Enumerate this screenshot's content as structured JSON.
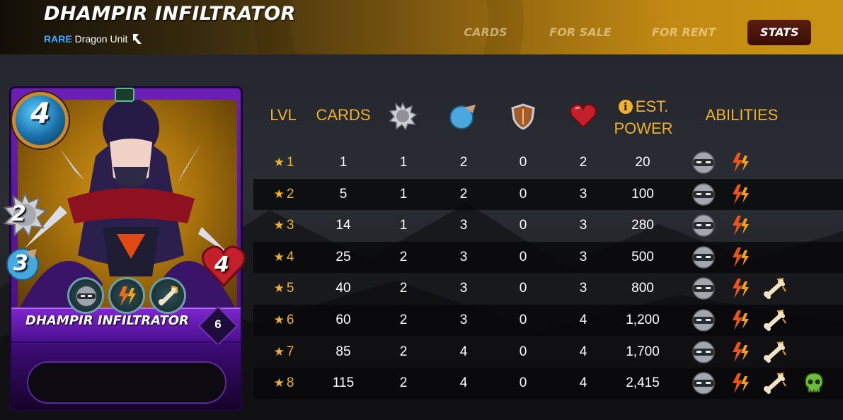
{
  "header": {
    "title": "DHAMPIR INFILTRATOR",
    "rarity": "RARE",
    "unit_type": "Dragon Unit",
    "tabs": [
      {
        "label": "CARDS",
        "active": false
      },
      {
        "label": "FOR SALE",
        "active": false
      },
      {
        "label": "FOR RENT",
        "active": false
      },
      {
        "label": "STATS",
        "active": true
      }
    ]
  },
  "card": {
    "name": "DHAMPIR INFILTRATOR",
    "level": "6",
    "mana": "4",
    "attack": "2",
    "speed": "3",
    "health": "4",
    "abilities": [
      "sneak-icon",
      "blast-icon",
      "scavenger-icon"
    ]
  },
  "table": {
    "headers": {
      "level": "LVL",
      "cards": "CARDS",
      "attack_icon": "melee-attack-icon",
      "speed_icon": "speed-icon",
      "armor_icon": "armor-shield-icon",
      "health_icon": "health-heart-icon",
      "power_line1": "EST.",
      "power_line2": "POWER",
      "abilities": "ABILITIES"
    },
    "star": "★",
    "rows": [
      {
        "level": "1",
        "cards": "1",
        "attack": "1",
        "speed": "2",
        "armor": "0",
        "health": "2",
        "power": "20",
        "abilities": [
          "sneak-icon",
          "blast-icon"
        ]
      },
      {
        "level": "2",
        "cards": "5",
        "attack": "1",
        "speed": "2",
        "armor": "0",
        "health": "3",
        "power": "100",
        "abilities": [
          "sneak-icon",
          "blast-icon"
        ]
      },
      {
        "level": "3",
        "cards": "14",
        "attack": "1",
        "speed": "3",
        "armor": "0",
        "health": "3",
        "power": "280",
        "abilities": [
          "sneak-icon",
          "blast-icon"
        ]
      },
      {
        "level": "4",
        "cards": "25",
        "attack": "2",
        "speed": "3",
        "armor": "0",
        "health": "3",
        "power": "500",
        "abilities": [
          "sneak-icon",
          "blast-icon"
        ]
      },
      {
        "level": "5",
        "cards": "40",
        "attack": "2",
        "speed": "3",
        "armor": "0",
        "health": "3",
        "power": "800",
        "abilities": [
          "sneak-icon",
          "blast-icon",
          "scavenger-icon"
        ]
      },
      {
        "level": "6",
        "cards": "60",
        "attack": "2",
        "speed": "3",
        "armor": "0",
        "health": "4",
        "power": "1,200",
        "abilities": [
          "sneak-icon",
          "blast-icon",
          "scavenger-icon"
        ]
      },
      {
        "level": "7",
        "cards": "85",
        "attack": "2",
        "speed": "4",
        "armor": "0",
        "health": "4",
        "power": "1,700",
        "abilities": [
          "sneak-icon",
          "blast-icon",
          "scavenger-icon"
        ]
      },
      {
        "level": "8",
        "cards": "115",
        "attack": "2",
        "speed": "4",
        "armor": "0",
        "health": "4",
        "power": "2,415",
        "abilities": [
          "sneak-icon",
          "blast-icon",
          "scavenger-icon",
          "skull-icon"
        ]
      }
    ]
  },
  "colors": {
    "accent": "#f1b12e",
    "rarity": "#3fa7ff",
    "active_tab": "#4a150a",
    "card_frame": "#6d1fb7"
  }
}
